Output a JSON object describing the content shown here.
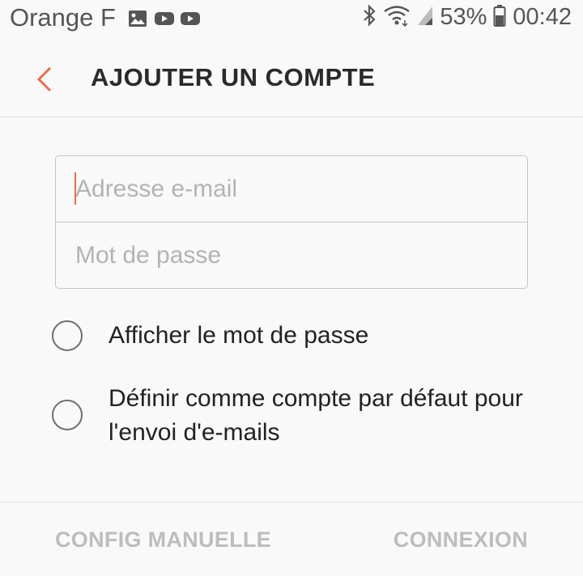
{
  "status_bar": {
    "carrier": "Orange F",
    "left_icons": [
      "image-icon",
      "youtube-icon",
      "youtube-icon"
    ],
    "right_icons": [
      "bluetooth-icon",
      "wifi-icon",
      "signal-icon",
      "battery-icon"
    ],
    "battery_percent": "53%",
    "time": "00:42"
  },
  "app_bar": {
    "title": "AJOUTER UN COMPTE",
    "back_icon": "chevron-left-icon",
    "accent_color": "#e8704a"
  },
  "form": {
    "email_placeholder": "Adresse e-mail",
    "email_value": "",
    "password_placeholder": "Mot de passe",
    "password_value": ""
  },
  "options": [
    {
      "label": "Afficher le mot de passe",
      "checked": false
    },
    {
      "label": "Définir comme compte par défaut pour l'envoi d'e-mails",
      "checked": false
    }
  ],
  "bottom_bar": {
    "manual_config_label": "CONFIG MANUELLE",
    "login_label": "CONNEXION"
  }
}
